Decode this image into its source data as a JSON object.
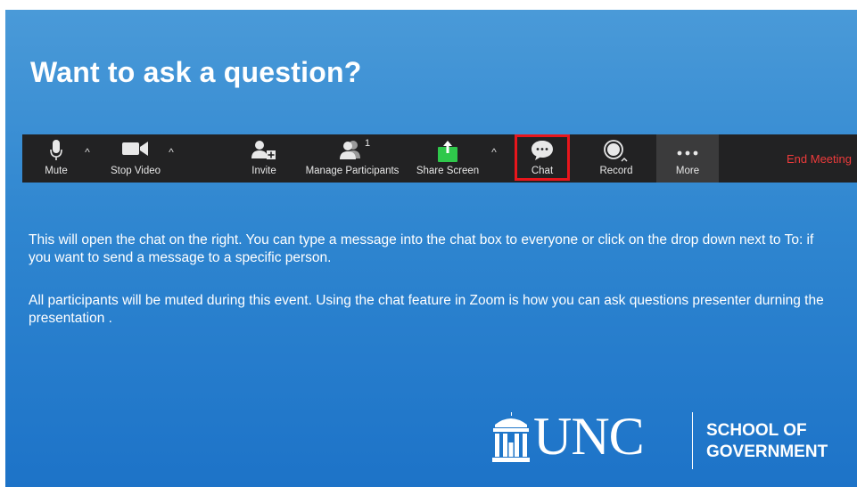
{
  "slide": {
    "title": "Want to ask a question?",
    "paragraph_1": "This will open the chat on the right. You can type a message into the chat box to everyone or click on the drop down next to To: if you want to send a message to a specific person.",
    "paragraph_2": "All participants will be muted during this event.  Using the chat feature in Zoom is how you can ask questions presenter durning the presentation ."
  },
  "toolbar": {
    "mute_label": "Mute",
    "stop_video_label": "Stop Video",
    "invite_label": "Invite",
    "participants_label": "Manage Participants",
    "participants_count": "1",
    "share_label": "Share Screen",
    "chat_label": "Chat",
    "record_label": "Record",
    "more_label": "More",
    "end_label": "End Meeting",
    "caret": "^",
    "highlight_color": "#e8161c",
    "share_icon_color": "#2fc84b",
    "end_color": "#ee3b3b"
  },
  "logo": {
    "unc": "UNC",
    "school_line1": "SCHOOL OF",
    "school_line2": "GOVERNMENT"
  }
}
